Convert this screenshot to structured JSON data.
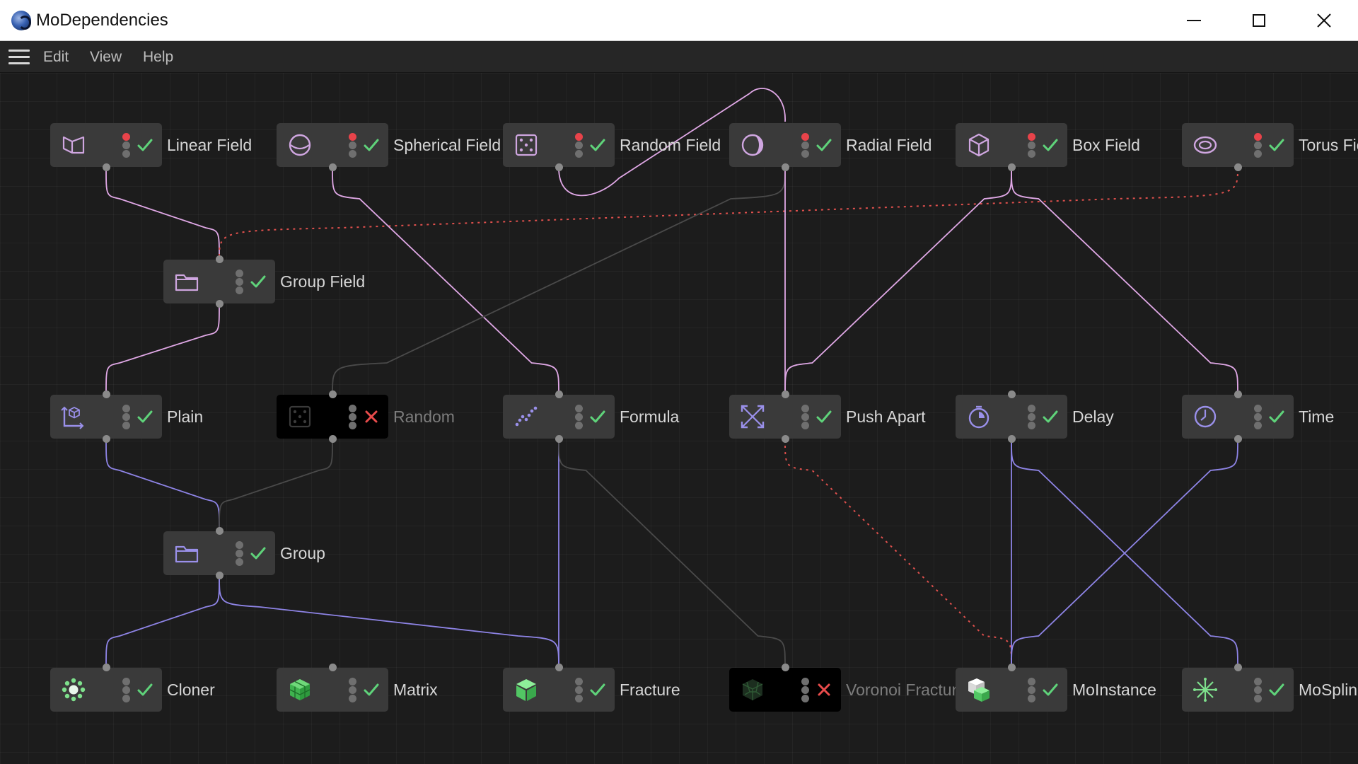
{
  "window": {
    "title": "MoDependencies"
  },
  "menu": {
    "items": [
      "Edit",
      "View",
      "Help"
    ]
  },
  "colors": {
    "canvas_bg": "#1c1c1c",
    "node_bg": "#3a3a3a",
    "node_disabled_bg": "#000000",
    "wire_field": "#e0a8e6",
    "wire_effector": "#8e84e6",
    "wire_inactive": "#4a4a4a",
    "wire_dotted": "#e0504d",
    "status_ok": "#5fd37a",
    "status_error": "#e84b4b",
    "dot_red": "#e8434a",
    "dot_grey": "#6f6f6f"
  },
  "nodes": [
    {
      "id": "linear_field",
      "label": "Linear Field",
      "icon": "linear-field-icon",
      "status": "ok",
      "red_dot": true,
      "enabled": true,
      "ports": [
        "bottom"
      ]
    },
    {
      "id": "spherical_field",
      "label": "Spherical Field",
      "icon": "spherical-field-icon",
      "status": "ok",
      "red_dot": true,
      "enabled": true,
      "ports": [
        "bottom"
      ]
    },
    {
      "id": "random_field",
      "label": "Random Field",
      "icon": "random-field-icon",
      "status": "ok",
      "red_dot": true,
      "enabled": true,
      "ports": [
        "bottom"
      ]
    },
    {
      "id": "radial_field",
      "label": "Radial Field",
      "icon": "radial-field-icon",
      "status": "ok",
      "red_dot": true,
      "enabled": true,
      "ports": [
        "bottom"
      ]
    },
    {
      "id": "box_field",
      "label": "Box Field",
      "icon": "box-field-icon",
      "status": "ok",
      "red_dot": true,
      "enabled": true,
      "ports": [
        "bottom"
      ]
    },
    {
      "id": "torus_field",
      "label": "Torus Fie",
      "icon": "torus-field-icon",
      "status": "ok",
      "red_dot": true,
      "enabled": true,
      "ports": [
        "bottom"
      ]
    },
    {
      "id": "group_field",
      "label": "Group Field",
      "icon": "folder-icon",
      "status": "ok",
      "red_dot": false,
      "enabled": true,
      "ports": [
        "top",
        "bottom"
      ]
    },
    {
      "id": "plain",
      "label": "Plain",
      "icon": "plain-effector-icon",
      "status": "ok",
      "red_dot": false,
      "enabled": true,
      "ports": [
        "top",
        "bottom"
      ]
    },
    {
      "id": "random",
      "label": "Random",
      "icon": "random-effector-icon",
      "status": "error",
      "red_dot": false,
      "enabled": false,
      "ports": [
        "top",
        "bottom"
      ]
    },
    {
      "id": "formula",
      "label": "Formula",
      "icon": "formula-effector-icon",
      "status": "ok",
      "red_dot": false,
      "enabled": true,
      "ports": [
        "top",
        "bottom"
      ]
    },
    {
      "id": "push_apart",
      "label": "Push Apart",
      "icon": "push-apart-effector-icon",
      "status": "ok",
      "red_dot": false,
      "enabled": true,
      "ports": [
        "top",
        "bottom"
      ]
    },
    {
      "id": "delay",
      "label": "Delay",
      "icon": "delay-effector-icon",
      "status": "ok",
      "red_dot": false,
      "enabled": true,
      "ports": [
        "top",
        "bottom"
      ]
    },
    {
      "id": "time",
      "label": "Time",
      "icon": "time-effector-icon",
      "status": "ok",
      "red_dot": false,
      "enabled": true,
      "ports": [
        "top",
        "bottom"
      ]
    },
    {
      "id": "group",
      "label": "Group",
      "icon": "folder-icon",
      "status": "ok",
      "red_dot": false,
      "enabled": true,
      "ports": [
        "top",
        "bottom"
      ]
    },
    {
      "id": "cloner",
      "label": "Cloner",
      "icon": "cloner-icon",
      "status": "ok",
      "red_dot": false,
      "enabled": true,
      "ports": [
        "top"
      ]
    },
    {
      "id": "matrix",
      "label": "Matrix",
      "icon": "matrix-icon",
      "status": "ok",
      "red_dot": false,
      "enabled": true,
      "ports": [
        "top"
      ]
    },
    {
      "id": "fracture",
      "label": "Fracture",
      "icon": "fracture-icon",
      "status": "ok",
      "red_dot": false,
      "enabled": true,
      "ports": [
        "top"
      ]
    },
    {
      "id": "voronoi_fracture",
      "label": "Voronoi Fracture",
      "icon": "voronoi-fracture-icon",
      "status": "error",
      "red_dot": false,
      "enabled": false,
      "ports": [
        "top"
      ]
    },
    {
      "id": "moinstance",
      "label": "MoInstance",
      "icon": "moinstance-icon",
      "status": "ok",
      "red_dot": false,
      "enabled": true,
      "ports": [
        "top"
      ]
    },
    {
      "id": "mospline",
      "label": "MoSplin",
      "icon": "mospline-icon",
      "status": "ok",
      "red_dot": false,
      "enabled": true,
      "ports": [
        "top"
      ]
    }
  ],
  "connections": [
    {
      "from": "linear_field",
      "to": "group_field",
      "style": "field"
    },
    {
      "from": "torus_field",
      "to": "group_field",
      "style": "dotted"
    },
    {
      "from": "random_field",
      "to": "radial_field",
      "style": "field",
      "kind": "loop"
    },
    {
      "from": "spherical_field",
      "to": "formula",
      "style": "field"
    },
    {
      "from": "radial_field",
      "to": "random",
      "style": "inactive"
    },
    {
      "from": "radial_field",
      "to": "push_apart",
      "style": "field"
    },
    {
      "from": "box_field",
      "to": "push_apart",
      "style": "field"
    },
    {
      "from": "box_field",
      "to": "time",
      "style": "field"
    },
    {
      "from": "group_field",
      "to": "plain",
      "style": "field"
    },
    {
      "from": "plain",
      "to": "group",
      "style": "effector"
    },
    {
      "from": "random",
      "to": "group",
      "style": "inactive"
    },
    {
      "from": "group",
      "to": "cloner",
      "style": "effector"
    },
    {
      "from": "group",
      "to": "fracture",
      "style": "effector"
    },
    {
      "from": "formula",
      "to": "fracture",
      "style": "effector"
    },
    {
      "from": "formula",
      "to": "voronoi_fracture",
      "style": "inactive"
    },
    {
      "from": "push_apart",
      "to": "moinstance",
      "style": "dotted"
    },
    {
      "from": "delay",
      "to": "moinstance",
      "style": "effector"
    },
    {
      "from": "delay",
      "to": "mospline",
      "style": "effector"
    },
    {
      "from": "time",
      "to": "moinstance",
      "style": "effector"
    }
  ]
}
